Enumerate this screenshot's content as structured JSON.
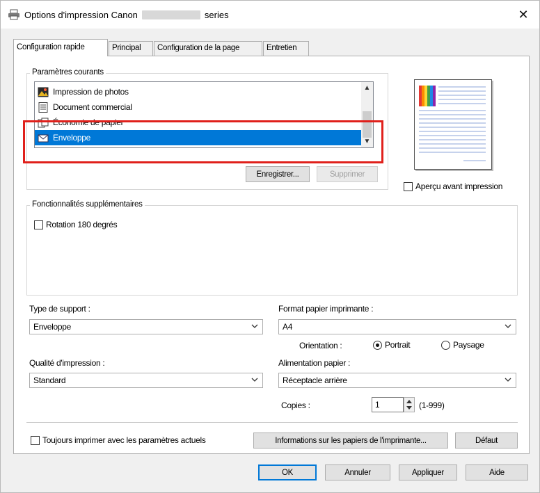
{
  "window": {
    "title_prefix": "Options d'impression Canon",
    "title_suffix": "series",
    "close_glyph": "✕",
    "printer_icon": "printer-icon"
  },
  "tabs": [
    {
      "label": "Configuration rapide",
      "active": true
    },
    {
      "label": "Principal",
      "active": false
    },
    {
      "label": "Configuration de la page",
      "active": false
    },
    {
      "label": "Entretien",
      "active": false
    }
  ],
  "current_settings": {
    "legend": "Paramètres courants",
    "items": [
      {
        "label": "Impression de photos",
        "icon": "photo-icon",
        "selected": false
      },
      {
        "label": "Document commercial",
        "icon": "document-icon",
        "selected": false
      },
      {
        "label": "Économie de papier",
        "icon": "paper-icon",
        "selected": false
      },
      {
        "label": "Enveloppe",
        "icon": "envelope-icon",
        "selected": true
      }
    ],
    "save_label": "Enregistrer...",
    "delete_label": "Supprimer"
  },
  "preview": {
    "checkbox_label": "Aperçu avant impression",
    "checked": false
  },
  "additional_features": {
    "legend": "Fonctionnalités supplémentaires",
    "rotate_label": "Rotation 180 degrés",
    "rotate_checked": false
  },
  "media": {
    "label": "Type de support :",
    "value": "Enveloppe"
  },
  "paper_size": {
    "label": "Format papier imprimante :",
    "value": "A4"
  },
  "orientation": {
    "label": "Orientation :",
    "portrait": "Portrait",
    "landscape": "Paysage",
    "selected": "portrait"
  },
  "quality": {
    "label": "Qualité d'impression :",
    "value": "Standard"
  },
  "paper_source": {
    "label": "Alimentation papier :",
    "value": "Réceptacle arrière"
  },
  "copies": {
    "label": "Copies :",
    "value": "1",
    "range": "(1-999)"
  },
  "always_print": {
    "label": "Toujours imprimer avec les paramètres actuels",
    "checked": false
  },
  "printer_media_info_label": "Informations sur les papiers de l'imprimante...",
  "default_label": "Défaut",
  "footer": {
    "ok": "OK",
    "cancel": "Annuler",
    "apply": "Appliquer",
    "help": "Aide"
  },
  "colors": {
    "selection": "#0078d7",
    "highlight_border": "#e0201b"
  }
}
